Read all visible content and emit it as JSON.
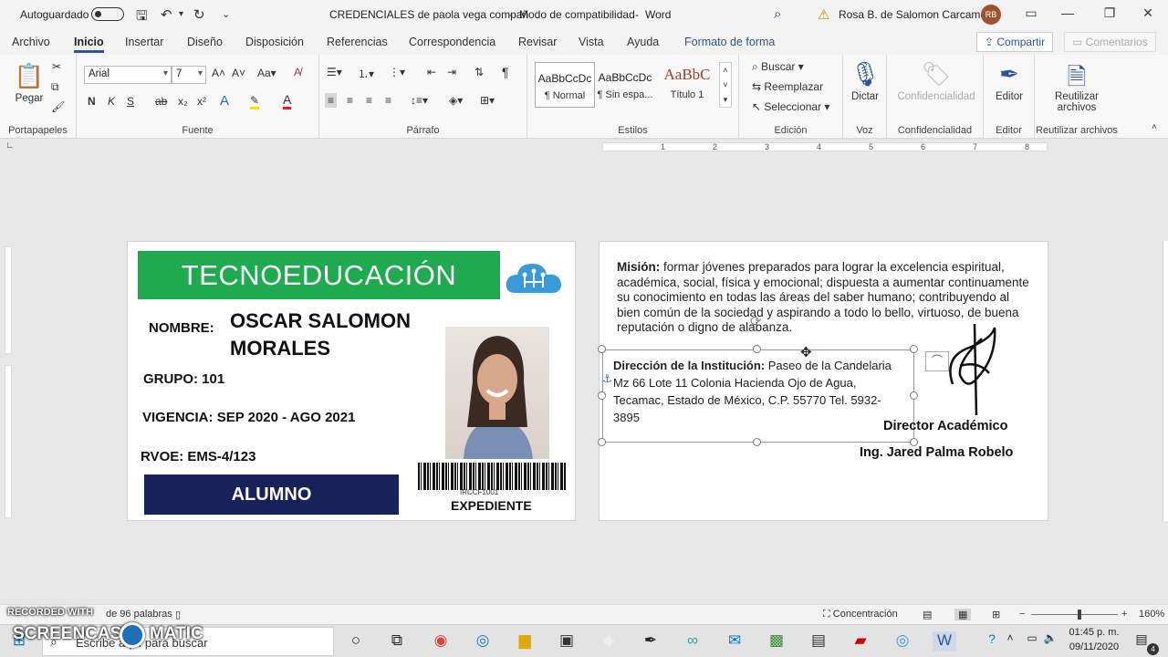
{
  "titlebar": {
    "autosave_label": "Autoguardado",
    "doc_title": "CREDENCIALES de paola vega compañ",
    "mode": "Modo de compatibilidad",
    "app": "Word",
    "separator": "-",
    "warning_icon": "warning-icon",
    "user_name": "Rosa B. de Salomon Carcamo",
    "user_initials": "RB"
  },
  "tabs": [
    {
      "label": "Archivo"
    },
    {
      "label": "Inicio"
    },
    {
      "label": "Insertar"
    },
    {
      "label": "Diseño"
    },
    {
      "label": "Disposición"
    },
    {
      "label": "Referencias"
    },
    {
      "label": "Correspondencia"
    },
    {
      "label": "Revisar"
    },
    {
      "label": "Vista"
    },
    {
      "label": "Ayuda"
    },
    {
      "label": "Formato de forma"
    }
  ],
  "share_label": "Compartir",
  "comments_label": "Comentarios",
  "ribbon": {
    "paste_label": "Pegar",
    "clipboard_group": "Portapapeles",
    "font_name": "Arial",
    "font_size": "7",
    "font_group": "Fuente",
    "bold": "N",
    "italic": "K",
    "underline": "S",
    "strike": "ab",
    "paragraph_group": "Párrafo",
    "styles": [
      {
        "sample": "AaBbCcDc",
        "name": "¶ Normal"
      },
      {
        "sample": "AaBbCcDc",
        "name": "¶ Sin espa..."
      },
      {
        "sample": "AaBbC",
        "name": "Título 1"
      }
    ],
    "styles_group": "Estilos",
    "find": "Buscar",
    "replace": "Reemplazar",
    "select": "Seleccionar",
    "editing_group": "Edición",
    "dictate": "Dictar",
    "voice_group": "Voz",
    "confidentiality": "Confidencialidad",
    "confidentiality_group": "Confidencialidad",
    "editor": "Editor",
    "editor_group": "Editor",
    "reuse_line1": "Reutilizar",
    "reuse_line2": "archivos",
    "reuse_group": "Reutilizar archivos"
  },
  "ruler_numbers": [
    "1",
    "2",
    "3",
    "4",
    "5",
    "6",
    "7",
    "8"
  ],
  "card_front": {
    "brand": "TECNOEDUCACIÓN",
    "name_label": "NOMBRE:",
    "name_line1": "OSCAR SALOMON",
    "name_line2": "MORALES",
    "group_label": "GRUPO:",
    "group_value": "101",
    "validity_label": "VIGENCIA:",
    "validity_value": "SEP 2020 - AGO 2021",
    "rvoe_label": "RVOE:",
    "rvoe_value": "EMS-4/123",
    "role": "ALUMNO",
    "barcode_text": "IRCCF1001",
    "expediente": "EXPEDIENTE",
    "logo_icon": "cloud-circuit-icon"
  },
  "card_back": {
    "mission_label": "Misión:",
    "mission_text": "formar jóvenes preparados para lograr la excelencia espiritual, académica, social, física y emocional; dispuesta a aumentar continuamente su conocimiento en todas las áreas del saber humano; contribuyendo al bien común de la sociedad y aspirando a todo lo bello, virtuoso, de buena reputación o digno de alabanza.",
    "address_label": "Dirección de la Institución:",
    "address_text": "Paseo de la Candelaria Mz 66 Lote 11 Colonia Hacienda Ojo de Agua, Tecamac, Estado de México, C.P. 55770 Tel. 5932-3895",
    "signer_title": "Director Académico",
    "signer_name": "Ing. Jared Palma Robelo"
  },
  "status": {
    "words": "de 96 palabras",
    "focus": "Concentración",
    "zoom": "160%"
  },
  "taskbar": {
    "search_placeholder": "Escribe aquí para buscar",
    "time": "01:45 p. m.",
    "date": "09/11/2020",
    "notifications": "4"
  },
  "watermark": {
    "line1": "RECORDED WITH",
    "line2a": "SCREENCAST",
    "line2b": "MATIC"
  }
}
